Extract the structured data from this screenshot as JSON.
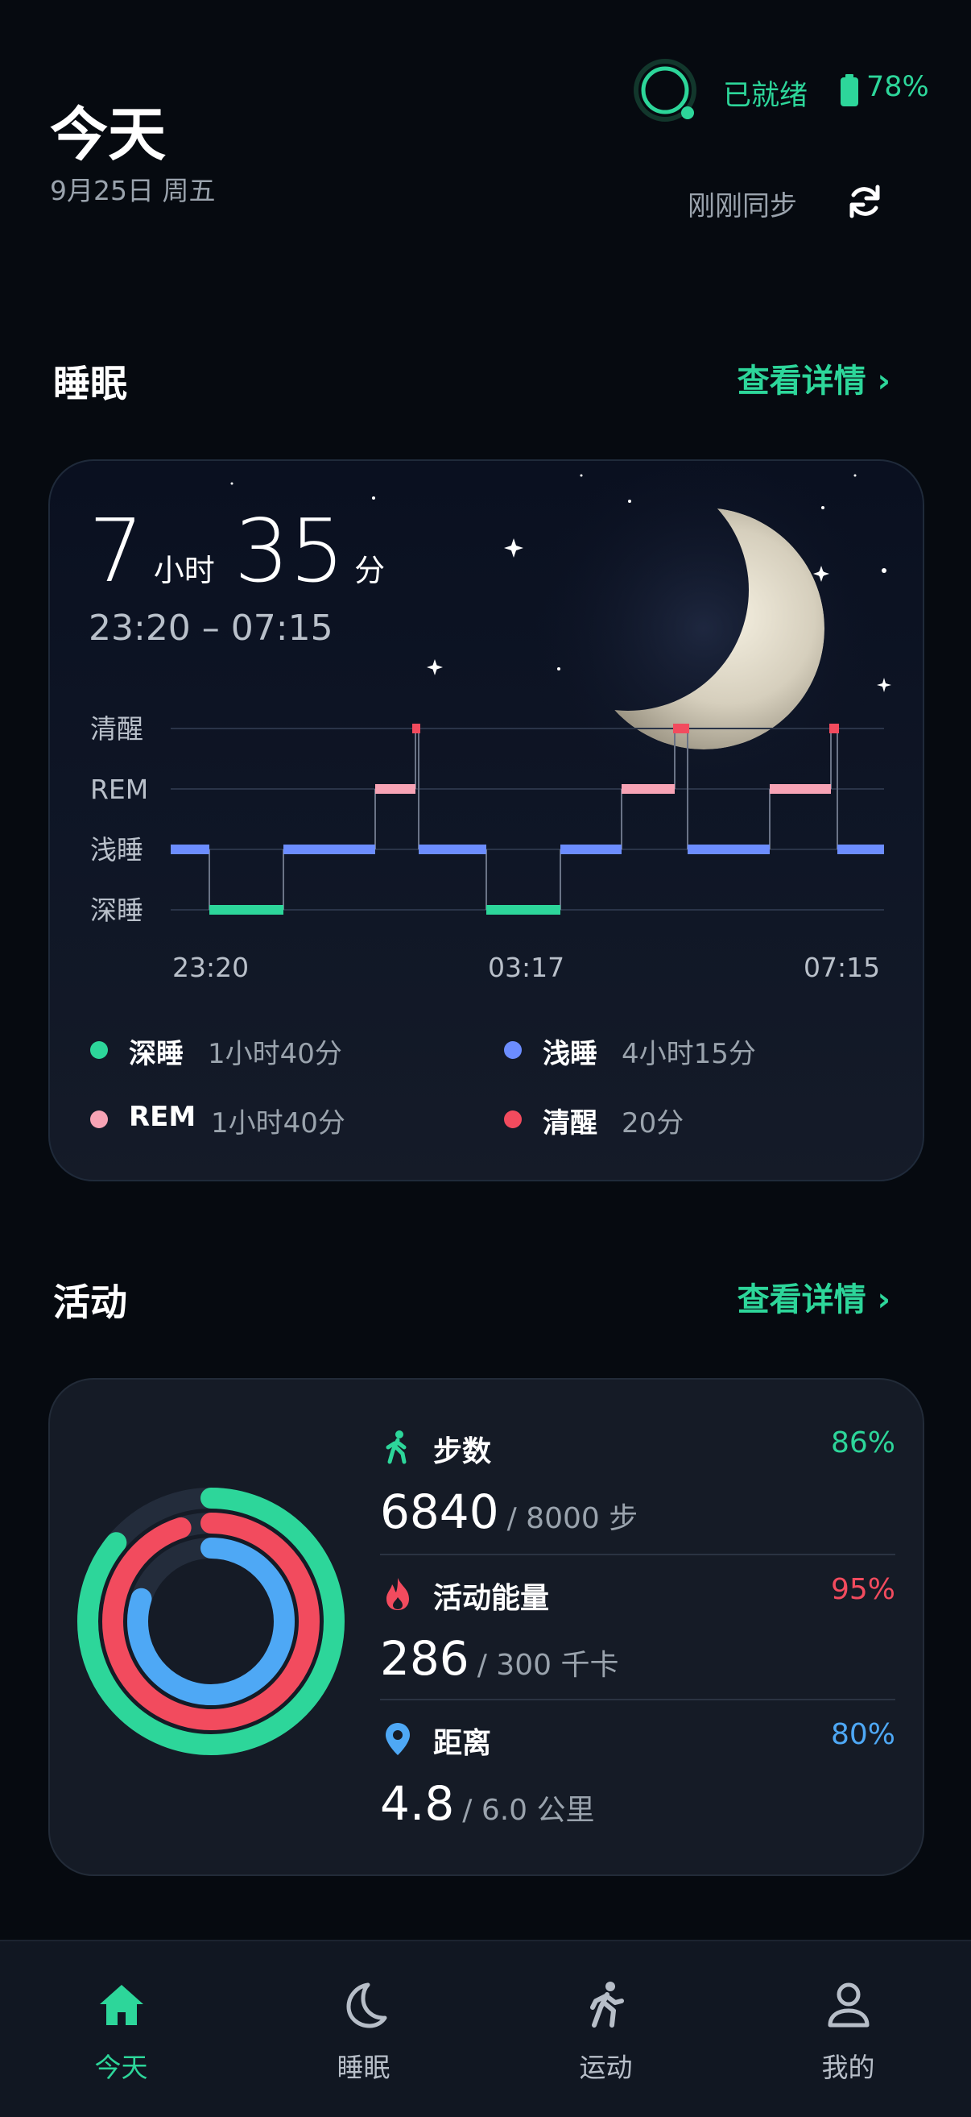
{
  "header": {
    "title": "今天",
    "date": "9月25日 周五",
    "device_status": "已就绪",
    "battery": "78%",
    "sync_text": "刚刚同步"
  },
  "sleep": {
    "section_title": "睡眠",
    "details_link": "查看详情 ›",
    "hours": "7",
    "hours_unit": "小时",
    "minutes": "35",
    "minutes_unit": "分",
    "time_range": "23:20 – 07:15",
    "stage_labels": [
      "清醒",
      "REM",
      "浅睡",
      "深睡"
    ],
    "time_ticks": [
      "23:20",
      "03:17",
      "07:15"
    ],
    "legend": [
      {
        "name": "深睡",
        "value": "1小时40分",
        "color": "#2dd69a"
      },
      {
        "name": "浅睡",
        "value": "4小时15分",
        "color": "#6c8dff"
      },
      {
        "name": "REM",
        "value": "1小时40分",
        "color": "#f7a3b5"
      },
      {
        "name": "清醒",
        "value": "20分",
        "color": "#f24b5e"
      }
    ]
  },
  "activity": {
    "section_title": "活动",
    "details_link": "查看详情 ›",
    "metrics": [
      {
        "name": "步数",
        "value": "6840",
        "goal": "/ 8000 步",
        "percent": "86%",
        "fraction": 0.86,
        "color": "#2dd69a",
        "icon": "walking-icon"
      },
      {
        "name": "活动能量",
        "value": "286",
        "goal": "/ 300 千卡",
        "percent": "95%",
        "fraction": 0.95,
        "color": "#f24b5e",
        "icon": "flame-icon"
      },
      {
        "name": "距离",
        "value": "4.8",
        "goal": "/ 6.0 公里",
        "percent": "80%",
        "fraction": 0.8,
        "color": "#4ea8f5",
        "icon": "location-pin-icon"
      }
    ]
  },
  "nav": {
    "items": [
      {
        "label": "今天",
        "icon": "home-icon",
        "active": true
      },
      {
        "label": "睡眠",
        "icon": "moon-icon",
        "active": false
      },
      {
        "label": "运动",
        "icon": "running-icon",
        "active": false
      },
      {
        "label": "我的",
        "icon": "profile-icon",
        "active": false
      }
    ]
  },
  "colors": {
    "accent": "#2dd69a",
    "background": "#060a10",
    "card": "#151b26"
  }
}
